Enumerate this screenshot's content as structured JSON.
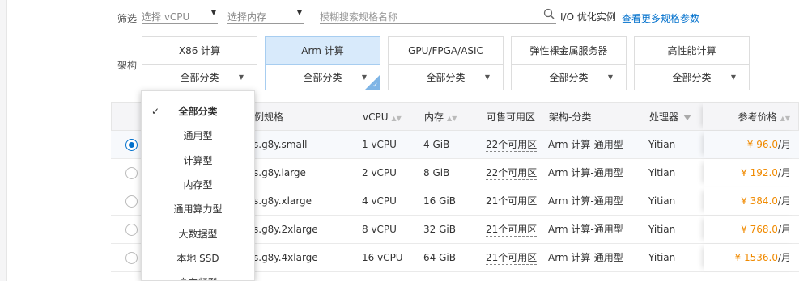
{
  "filter": {
    "label": "筛选",
    "vcpu_placeholder": "选择 vCPU",
    "memory_placeholder": "选择内存",
    "search_placeholder": "模糊搜索规格名称",
    "io_optimized_label": "I/O 优化实例",
    "more_specs_link": "查看更多规格参数"
  },
  "architecture": {
    "label": "架构",
    "cards": [
      {
        "title": "X86 计算",
        "category": "全部分类"
      },
      {
        "title": "Arm 计算",
        "category": "全部分类"
      },
      {
        "title": "GPU/FPGA/ASIC",
        "category": "全部分类"
      },
      {
        "title": "弹性裸金属服务器",
        "category": "全部分类"
      },
      {
        "title": "高性能计算",
        "category": "全部分类"
      }
    ]
  },
  "dropdown": {
    "items": [
      "全部分类",
      "通用型",
      "计算型",
      "内存型",
      "通用算力型",
      "大数据型",
      "本地 SSD",
      "高主频型"
    ],
    "selected": "全部分类"
  },
  "table": {
    "headers": {
      "spec": "例规格",
      "vcpu": "vCPU",
      "memory": "内存",
      "zones": "可售可用区",
      "arch_category": "架构-分类",
      "processor": "处理器",
      "price": "参考价格"
    },
    "rows": [
      {
        "spec": "s.g8y.small",
        "vcpu": "1 vCPU",
        "memory": "4 GiB",
        "zones": "22个可用区",
        "arch": "Arm 计算-通用型",
        "processor": "Yitian",
        "price": "¥ 96.0",
        "unit": "/月"
      },
      {
        "spec": "s.g8y.large",
        "vcpu": "2 vCPU",
        "memory": "8 GiB",
        "zones": "22个可用区",
        "arch": "Arm 计算-通用型",
        "processor": "Yitian",
        "price": "¥ 192.0",
        "unit": "/月"
      },
      {
        "spec": "s.g8y.xlarge",
        "vcpu": "4 vCPU",
        "memory": "16 GiB",
        "zones": "21个可用区",
        "arch": "Arm 计算-通用型",
        "processor": "Yitian",
        "price": "¥ 384.0",
        "unit": "/月"
      },
      {
        "spec": "s.g8y.2xlarge",
        "vcpu": "8 vCPU",
        "memory": "32 GiB",
        "zones": "21个可用区",
        "arch": "Arm 计算-通用型",
        "processor": "Yitian",
        "price": "¥ 768.0",
        "unit": "/月"
      },
      {
        "spec": "s.g8y.4xlarge",
        "vcpu": "16 vCPU",
        "memory": "64 GiB",
        "zones": "21个可用区",
        "arch": "Arm 计算-通用型",
        "processor": "Yitian",
        "price": "¥ 1536.0",
        "unit": "/月"
      }
    ]
  },
  "colors": {
    "accent": "#0070cc",
    "price": "#f08a00",
    "active_card": "#d8eafb"
  }
}
